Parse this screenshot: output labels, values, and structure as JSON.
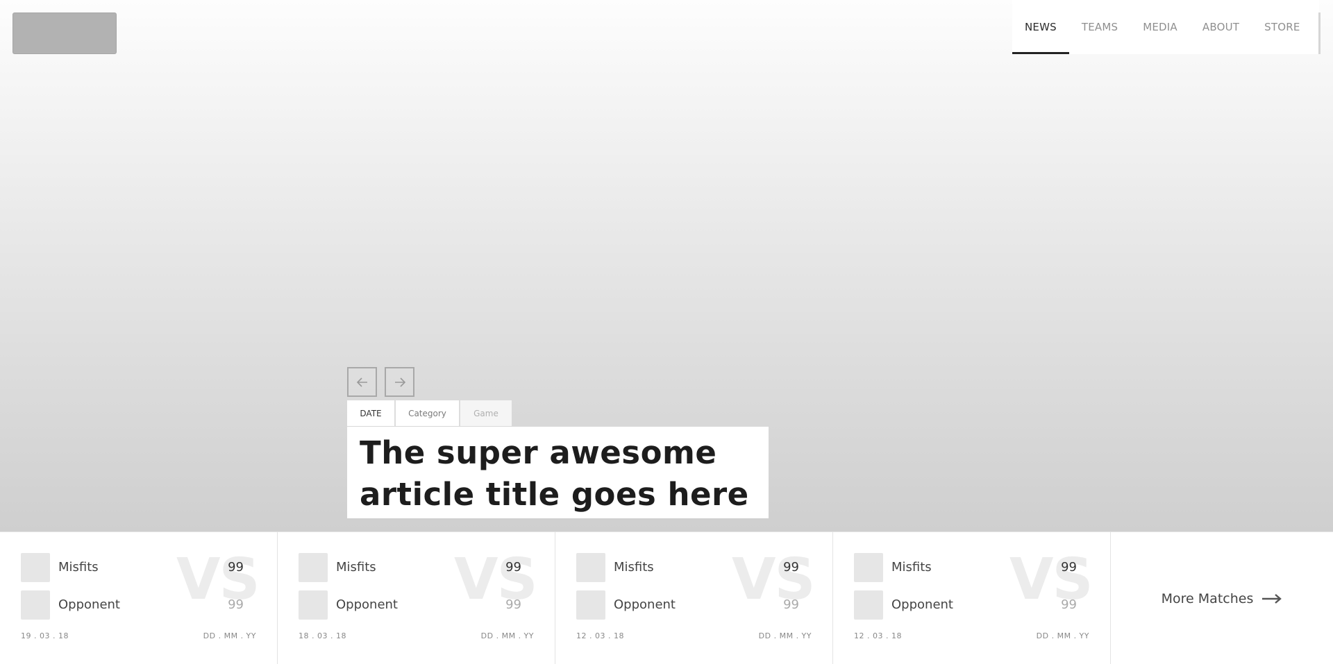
{
  "nav": {
    "items": [
      {
        "label": "NEWS",
        "active": true
      },
      {
        "label": "TEAMS",
        "active": false
      },
      {
        "label": "MEDIA",
        "active": false
      },
      {
        "label": "ABOUT",
        "active": false
      },
      {
        "label": "STORE",
        "active": false
      }
    ]
  },
  "slider": {
    "prev_icon": "arrow-left-icon",
    "next_icon": "arrow-right-icon"
  },
  "article": {
    "tags": {
      "date": "DATE",
      "category": "Category",
      "game": "Game"
    },
    "title": "The super awesome article title goes here"
  },
  "matches": [
    {
      "vs": "VS",
      "team1": "Misfits",
      "team2": "Opponent",
      "score1": "99",
      "score2": "99",
      "date": "19 . 03 . 18",
      "date2": "DD . MM . YY"
    },
    {
      "vs": "VS",
      "team1": "Misfits",
      "team2": "Opponent",
      "score1": "99",
      "score2": "99",
      "date": "18 . 03 . 18",
      "date2": "DD . MM . YY"
    },
    {
      "vs": "VS",
      "team1": "Misfits",
      "team2": "Opponent",
      "score1": "99",
      "score2": "99",
      "date": "12 . 03 . 18",
      "date2": "DD . MM . YY"
    },
    {
      "vs": "VS",
      "team1": "Misfits",
      "team2": "Opponent",
      "score1": "99",
      "score2": "99",
      "date": "12 . 03 . 18",
      "date2": "DD . MM . YY"
    }
  ],
  "more_matches": {
    "label": "More Matches",
    "icon": "long-arrow-right-icon"
  },
  "colors": {
    "nav_active": "#222222",
    "nav_inactive": "#8f8f8f",
    "title_text": "#1d1d1d",
    "placeholder_gray": "#b2b2b2"
  }
}
